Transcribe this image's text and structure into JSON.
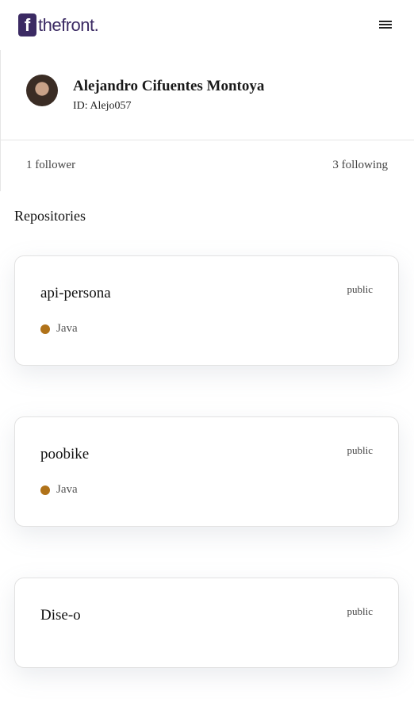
{
  "header": {
    "logo_mark": "f",
    "logo_text": "thefront.",
    "brand_color": "#3b2a63",
    "menu_icon": "menu-icon"
  },
  "profile": {
    "name": "Alejandro Cifuentes Montoya",
    "id_label": "ID: Alejo057",
    "followers": "1 follower",
    "following": "3 following"
  },
  "repositories": {
    "title": "Repositories",
    "items": [
      {
        "name": "api-persona",
        "visibility": "public",
        "language": "Java",
        "language_color": "#b07219"
      },
      {
        "name": "poobike",
        "visibility": "public",
        "language": "Java",
        "language_color": "#b07219"
      },
      {
        "name": "Dise-o",
        "visibility": "public"
      }
    ]
  }
}
